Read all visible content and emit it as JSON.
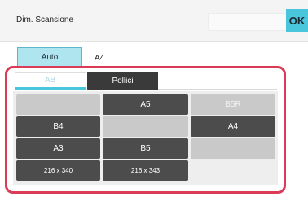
{
  "header": {
    "title": "Dim. Scansione",
    "ok_label": "OK"
  },
  "mode": {
    "button_label": "Auto",
    "current_size": "A4"
  },
  "tabs": [
    {
      "label": "AB",
      "active": true
    },
    {
      "label": "Pollici",
      "active": false
    }
  ],
  "sizes": {
    "blank_1": "",
    "a5": "A5",
    "b5r": "B5R",
    "b4": "B4",
    "blank_2": "",
    "a4": "A4",
    "a3": "A3",
    "b5": "B5",
    "blank_3": "",
    "custom_1": "216 x 340",
    "custom_2": "216 x 343"
  },
  "colors": {
    "accent": "#49c6dc",
    "highlight_frame": "#dc3b57",
    "button_dark": "#4c4c4c",
    "button_disabled": "#c9c9c9"
  }
}
